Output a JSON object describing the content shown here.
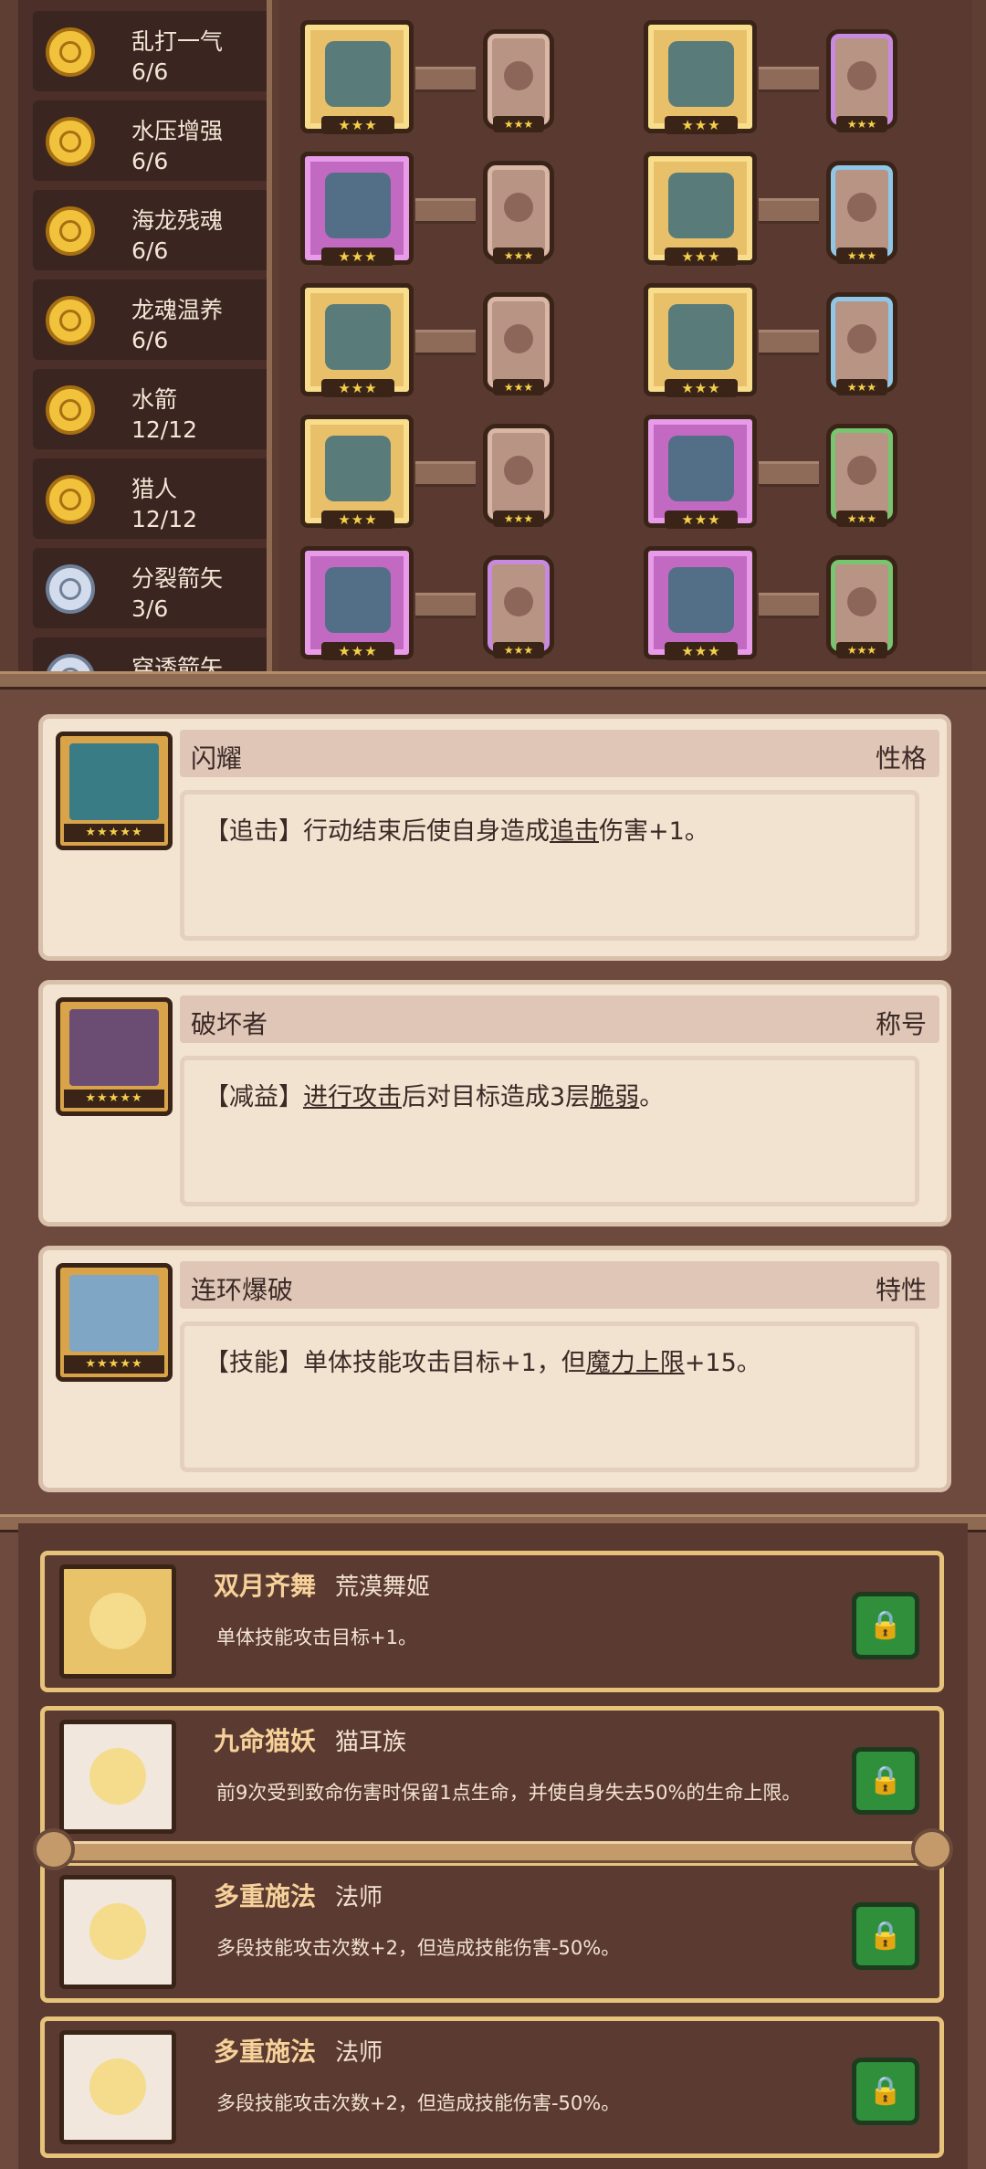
{
  "skills": [
    {
      "name": "乱打一气",
      "count": "6/6",
      "icon": "gold-coin-icon"
    },
    {
      "name": "水压增强",
      "count": "6/6",
      "icon": "gold-coin-icon"
    },
    {
      "name": "海龙残魂",
      "count": "6/6",
      "icon": "gold-coin-icon"
    },
    {
      "name": "龙魂温养",
      "count": "6/6",
      "icon": "gold-coin-icon"
    },
    {
      "name": "水箭",
      "count": "12/12",
      "icon": "gold-coin-icon"
    },
    {
      "name": "猎人",
      "count": "12/12",
      "icon": "gold-coin-icon"
    },
    {
      "name": "分裂箭矢",
      "count": "3/6",
      "icon": "silver-coin-icon"
    },
    {
      "name": "穿透箭矢",
      "count": "",
      "icon": "silver-coin-icon"
    }
  ],
  "equipment": {
    "star_text": "★★★",
    "items": [
      {
        "name": "crossbow-icon",
        "rarity": "gold",
        "card": "white"
      },
      {
        "name": "goggles-icon",
        "rarity": "gold",
        "card": "purple"
      },
      {
        "name": "arrow-icon",
        "rarity": "purple",
        "card": "white"
      },
      {
        "name": "armor-vest-icon",
        "rarity": "gold",
        "card": "blue"
      },
      {
        "name": "necklace-icon",
        "rarity": "gold",
        "card": "white"
      },
      {
        "name": "shield-fragment-icon",
        "rarity": "gold",
        "card": "blue"
      },
      {
        "name": "ring-disc-icon",
        "rarity": "gold",
        "card": "white"
      },
      {
        "name": "float-ring-icon",
        "rarity": "purple",
        "card": "green"
      },
      {
        "name": "dark-ring-icon",
        "rarity": "purple",
        "card": "purple"
      },
      {
        "name": "flippers-icon",
        "rarity": "purple",
        "card": "green"
      }
    ]
  },
  "traits": [
    {
      "title": "闪耀",
      "type": "性格",
      "tag": "【追击】",
      "desc_pre": "行动结束后使自身造成",
      "desc_key": "追击",
      "desc_post": "伤害+1。",
      "stars": "★★★★★"
    },
    {
      "title": "破坏者",
      "type": "称号",
      "tag": "【减益】",
      "desc_pre": "",
      "desc_key": "进行攻击",
      "desc_mid": "后对目标造成3层",
      "desc_key2": "脆弱",
      "desc_post": "。",
      "stars": "★★★★★"
    },
    {
      "title": "连环爆破",
      "type": "特性",
      "tag": "【技能】",
      "desc_pre": "单体技能攻击目标+1，但",
      "desc_key": "魔力上限",
      "desc_post": "+15。",
      "stars": "★★★★★"
    }
  ],
  "buffs": [
    {
      "name": "双月齐舞",
      "sub": "荒漠舞姬",
      "desc": "单体技能攻击目标+1。",
      "icon": "star-badge-icon",
      "bg": "gold"
    },
    {
      "name": "九命猫妖",
      "sub": "猫耳族",
      "desc": "前9次受到致命伤害时保留1点生命，并使自身失去50%的生命上限。",
      "icon": "cat-face-icon",
      "bg": "white"
    },
    {
      "name": "多重施法",
      "sub": "法师",
      "desc": "多段技能攻击次数+2，但造成技能伤害-50%。",
      "icon": "magic-staff-icon",
      "bg": "white"
    },
    {
      "name": "多重施法",
      "sub": "法师",
      "desc": "多段技能攻击次数+2，但造成技能伤害-50%。",
      "icon": "magic-staff-icon",
      "bg": "white"
    }
  ],
  "lock_glyph": "🔒"
}
